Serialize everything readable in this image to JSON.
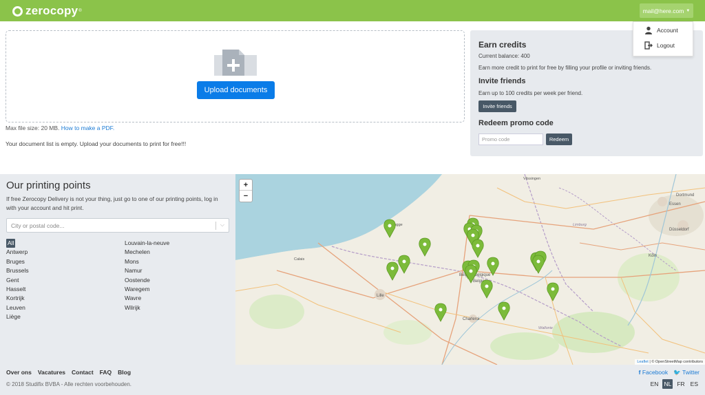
{
  "header": {
    "logo_text": "zerocopy",
    "logo_tm": "®",
    "user_email": "mail@here.com",
    "caret": "▼",
    "brand_color": "#8bc34a"
  },
  "user_menu": {
    "items": [
      {
        "label": "Account",
        "icon": "user-icon"
      },
      {
        "label": "Logout",
        "icon": "logout-icon"
      }
    ]
  },
  "upload": {
    "button_label": "Upload documents",
    "max_size_text": "Max file size: 20 MB.",
    "howto_link": "How to make a PDF.",
    "empty_message": "Your document list is empty. Upload your documents to print for free!!!"
  },
  "credits": {
    "title": "Earn credits",
    "balance": "Current balance: 400",
    "earn_desc": "Earn more credit to print for free by filling your profile or inviting friends.",
    "invite_title": "Invite friends",
    "invite_desc": "Earn up to 100 credits per week per friend.",
    "invite_button": "Invite friends",
    "promo_title": "Redeem promo code",
    "promo_placeholder": "Promo code",
    "redeem_button": "Redeem"
  },
  "points": {
    "title": "Our printing points",
    "description": "If free Zerocopy Delivery is not your thing, just go to one of our printing points, log in with your account and hit print.",
    "city_placeholder": "City or postal code...",
    "cities_col1": [
      "All",
      "Antwerp",
      "Bruges",
      "Brussels",
      "Gent",
      "Hasselt",
      "Kortrijk",
      "Leuven",
      "Liège"
    ],
    "cities_col2": [
      "Louvain-la-neuve",
      "Mechelen",
      "Mons",
      "Namur",
      "Oostende",
      "Waregem",
      "Wavre",
      "Wilrijk"
    ],
    "active_city": "All"
  },
  "map": {
    "zoom_in": "+",
    "zoom_out": "−",
    "attribution_leaflet": "Leaflet",
    "attribution_osm": " | © OpenStreetMap contributors",
    "labels": [
      "Vlissingen",
      "Essen",
      "Dortmund",
      "Düsseldorf",
      "Lille",
      "Charleroi",
      "Wallonie",
      "Köln",
      "Limburg",
      "België - Belgique - Belgien",
      "Calais",
      "Brugge"
    ],
    "marker_count": 22
  },
  "footer": {
    "links": [
      "Over ons",
      "Vacatures",
      "Contact",
      "FAQ",
      "Blog"
    ],
    "copyright": "© 2018 Studifix BVBA - Alle rechten voorbehouden.",
    "facebook": "Facebook",
    "twitter": "Twitter",
    "languages": [
      "EN",
      "NL",
      "FR",
      "ES"
    ],
    "active_language": "NL"
  }
}
